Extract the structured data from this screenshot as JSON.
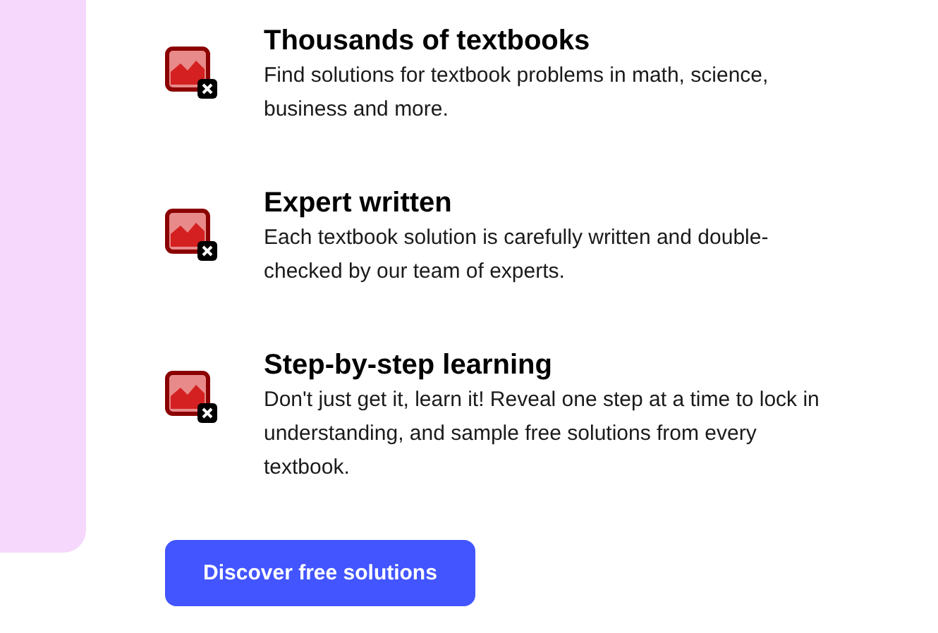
{
  "features": [
    {
      "title": "Thousands of textbooks",
      "description": "Find solutions for textbook problems in math, science, business and more."
    },
    {
      "title": "Expert written",
      "description": "Each textbook solution is carefully written and double-checked by our team of experts."
    },
    {
      "title": "Step-by-step learning",
      "description": "Don't just get it, learn it! Reveal one step at a time to lock in understanding, and sample free solutions from every textbook."
    }
  ],
  "button": "Discover free solutions"
}
